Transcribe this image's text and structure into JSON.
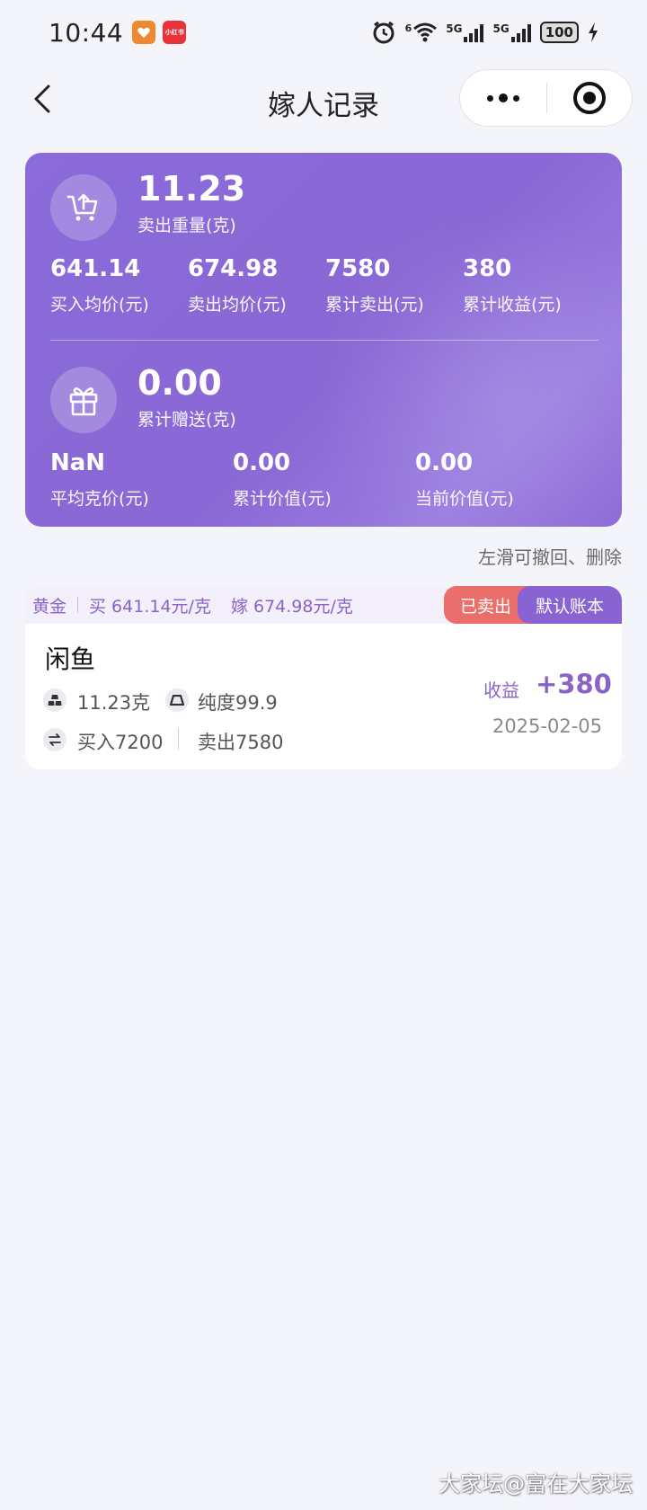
{
  "status_bar": {
    "time": "10:44",
    "badge_2_text": "小红书",
    "network_1": "6",
    "network_2": "5G",
    "network_3": "5G",
    "battery": "100"
  },
  "nav": {
    "title": "嫁人记录"
  },
  "summary": {
    "sold_weight": {
      "value": "11.23",
      "label": "卖出重量(克)"
    },
    "stats": [
      {
        "value": "641.14",
        "label": "买入均价(元)"
      },
      {
        "value": "674.98",
        "label": "卖出均价(元)"
      },
      {
        "value": "7580",
        "label": "累计卖出(元)"
      },
      {
        "value": "380",
        "label": "累计收益(元)"
      }
    ],
    "gifted": {
      "value": "0.00",
      "label": "累计赠送(克)"
    },
    "stats2": [
      {
        "value": "NaN",
        "label": "平均克价(元)"
      },
      {
        "value": "0.00",
        "label": "累计价值(元)"
      },
      {
        "value": "0.00",
        "label": "当前价值(元)"
      }
    ]
  },
  "hint": "左滑可撤回、删除",
  "record": {
    "metal": "黄金",
    "buy_price": "买 641.14元/克",
    "sell_price": "嫁 674.98元/克",
    "status_tag": "已卖出",
    "account_tag": "默认账本",
    "name": "闲鱼",
    "weight": "11.23克",
    "purity": "纯度99.9",
    "bought": "买入7200",
    "sold": "卖出7580",
    "profit_label": "收益",
    "profit_value": "+380",
    "date": "2025-02-05",
    "accent_color": "#8a63c9"
  },
  "watermark": "大家坛@富在大家坛"
}
